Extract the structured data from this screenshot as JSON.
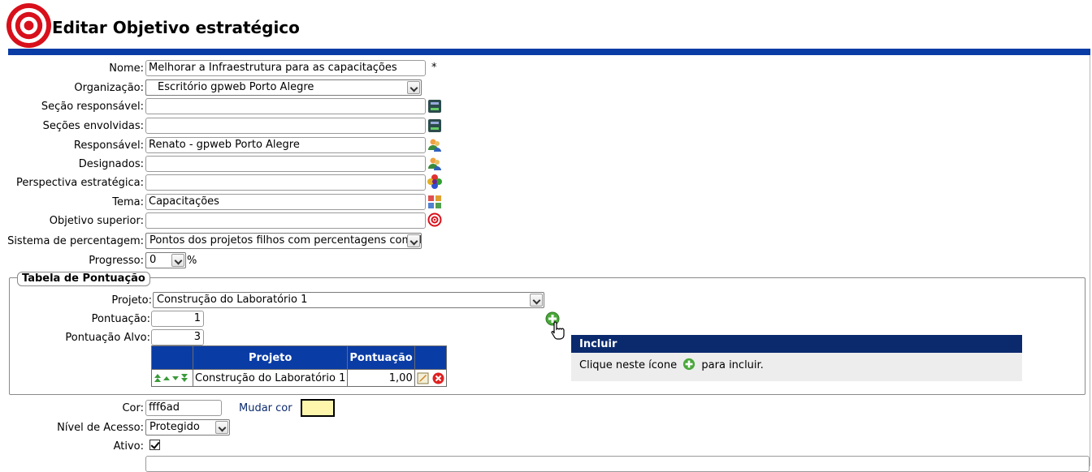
{
  "header": {
    "title": "Editar Objetivo estratégico",
    "logo_icon": "target-icon"
  },
  "form": {
    "nome": {
      "label": "Nome:",
      "value": "Melhorar a Infraestrutura para as capacitações",
      "required_mark": "*"
    },
    "organizacao": {
      "label": "Organização:",
      "value": "Escritório gpweb Porto Alegre"
    },
    "secao_responsavel": {
      "label": "Seção responsável:",
      "value": ""
    },
    "secoes_envolvidas": {
      "label": "Seções envolvidas:",
      "value": ""
    },
    "responsavel": {
      "label": "Responsável:",
      "value": "Renato - gpweb Porto Alegre"
    },
    "designados": {
      "label": "Designados:",
      "value": ""
    },
    "perspectiva": {
      "label": "Perspectiva estratégica:",
      "value": ""
    },
    "tema": {
      "label": "Tema:",
      "value": "Capacitações"
    },
    "objetivo_superior": {
      "label": "Objetivo superior:",
      "value": ""
    },
    "sistema_percentagem": {
      "label": "Sistema de percentagem:",
      "value": "Pontos dos projetos filhos com percentagens completa"
    },
    "progresso": {
      "label": "Progresso:",
      "value": "0",
      "unit": "%"
    },
    "cor": {
      "label": "Cor:",
      "value": "fff6ad",
      "change_label": "Mudar cor",
      "swatch_color": "#fff6ad"
    },
    "nivel_acesso": {
      "label": "Nível de Acesso:",
      "value": "Protegido"
    },
    "ativo": {
      "label": "Ativo:",
      "checked": true
    }
  },
  "tabela_pontuacao": {
    "legend": "Tabela de Pontuação",
    "projeto": {
      "label": "Projeto:",
      "value": "Construção do Laboratório 1"
    },
    "pontuacao": {
      "label": "Pontuação:",
      "value": "1"
    },
    "pontuacao_alvo": {
      "label": "Pontuação Alvo:",
      "value": "3"
    },
    "columns": [
      "",
      "Projeto",
      "Pontuação",
      ""
    ],
    "rows": [
      {
        "projeto": "Construção do Laboratório 1",
        "pontuacao": "1,00"
      }
    ]
  },
  "tooltip": {
    "title": "Incluir",
    "text_before": "Clique neste ícone",
    "text_after": "para incluir."
  },
  "colors": {
    "accent": "#0a3ca6",
    "tooltip_header": "#0b2a6e",
    "tooltip_bg": "#ededed"
  }
}
